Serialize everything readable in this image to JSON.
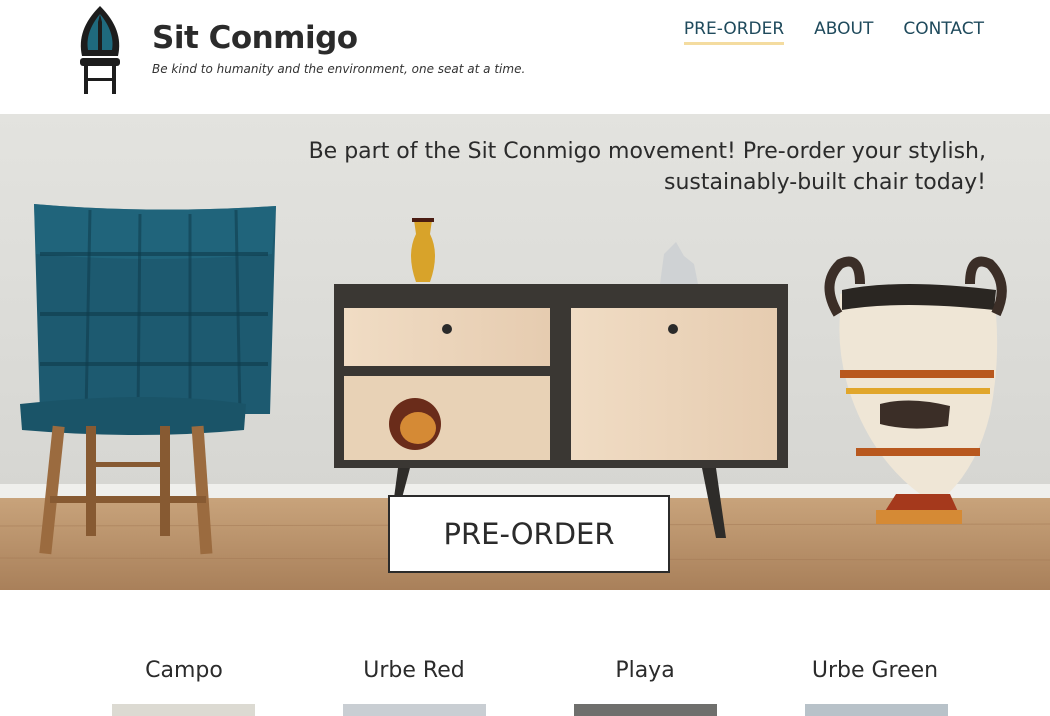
{
  "brand": {
    "title": "Sit Conmigo",
    "tagline": "Be kind to humanity and the environment, one seat at a time."
  },
  "nav": {
    "items": [
      {
        "label": "PRE-ORDER",
        "active": true
      },
      {
        "label": "ABOUT",
        "active": false
      },
      {
        "label": "CONTACT",
        "active": false
      }
    ]
  },
  "hero": {
    "headline": "Be part of the Sit Conmigo movement! Pre-order your stylish, sustainably-built chair today!",
    "cta_label": "PRE-ORDER"
  },
  "products": [
    {
      "name": "Campo"
    },
    {
      "name": "Urbe Red"
    },
    {
      "name": "Playa"
    },
    {
      "name": "Urbe Green"
    }
  ],
  "colors": {
    "nav_text": "#1f4a5c",
    "nav_active_underline": "#f4dca0",
    "chair_fabric": "#1d5a70",
    "wall": "#dcdcd8",
    "floor": "#b98f63"
  },
  "icons": {
    "logo": "chair-logo-icon"
  }
}
